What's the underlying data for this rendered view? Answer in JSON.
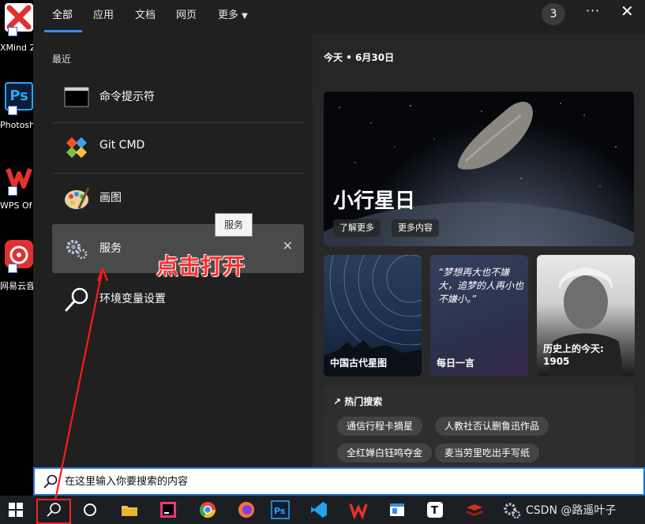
{
  "desktop": {
    "icons": [
      {
        "label": "XMind 2",
        "icon": "xmind-icon"
      },
      {
        "label": "Photosh",
        "icon": "photoshop-icon"
      },
      {
        "label": "WPS Of",
        "icon": "wps-icon"
      },
      {
        "label": "网易云音",
        "icon": "netease-music-icon"
      }
    ]
  },
  "tabs": {
    "all": "全部",
    "apps": "应用",
    "docs": "文档",
    "web": "网页",
    "more": "更多",
    "badge": "3",
    "options": "···",
    "close": "✕"
  },
  "recent": {
    "title": "最近",
    "items": [
      {
        "label": "命令提示符",
        "icon": "cmd-icon"
      },
      {
        "label": "Git CMD",
        "icon": "git-icon"
      },
      {
        "label": "画图",
        "icon": "paint-icon"
      },
      {
        "label": "服务",
        "icon": "services-gear-icon"
      },
      {
        "label": "环境变量设置",
        "icon": "search-icon"
      }
    ],
    "remove": "✕",
    "tooltip": "服务"
  },
  "today": {
    "date": "今天 • 6月30日",
    "hero": {
      "title": "小行星日",
      "learn_more": "了解更多",
      "more_content": "更多内容"
    },
    "cards": [
      {
        "caption": "中国古代星图"
      },
      {
        "caption": "每日一言",
        "quote": "“梦想再大也不嫌大，追梦的人再小也不嫌小。”"
      },
      {
        "caption": "历史上的今天:",
        "year": "1905"
      }
    ],
    "hot": {
      "title": "热门搜索",
      "pills": [
        "通信行程卡摘星",
        "人教社否认删鲁迅作品",
        "全红婵白钰鸣夺金",
        "麦当劳里吃出手写纸"
      ]
    }
  },
  "search": {
    "placeholder": "在这里输入你要搜索的内容"
  },
  "annotation": {
    "text": "点击打开"
  },
  "taskbar": {
    "watermark": "CSDN @路遥叶子"
  },
  "colors": {
    "accent": "#3b8be8",
    "annotation": "#ff2e2e"
  }
}
